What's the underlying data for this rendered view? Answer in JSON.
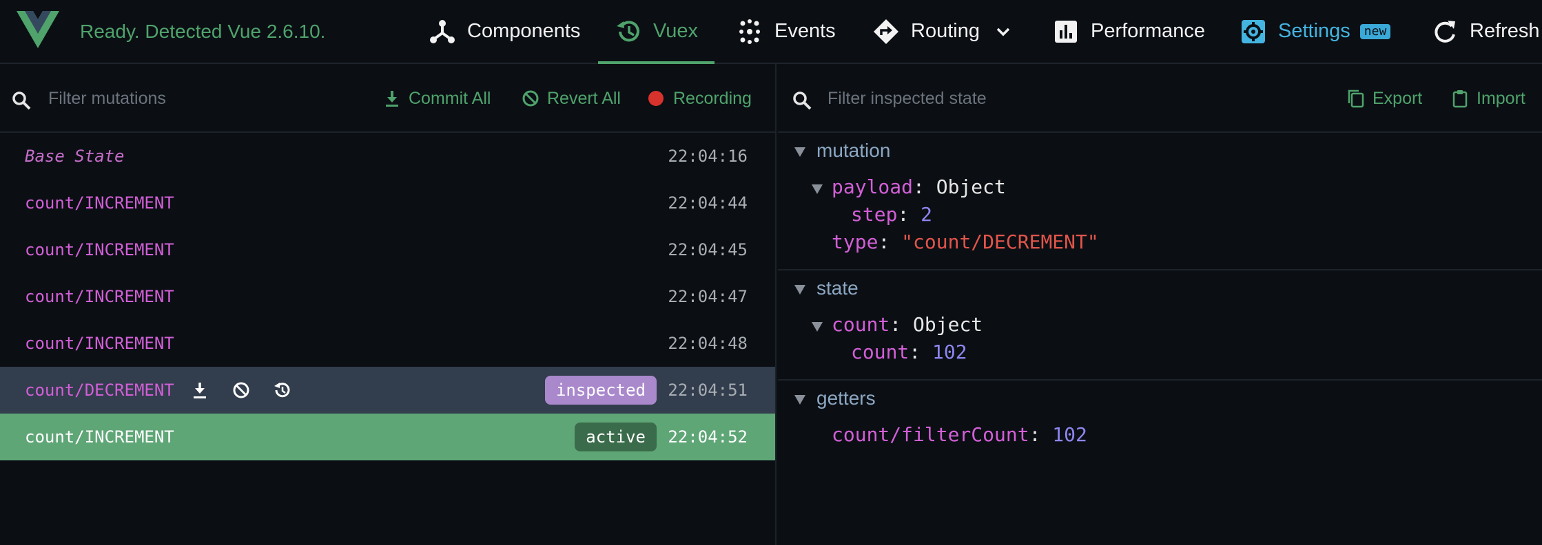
{
  "header": {
    "status": "Ready. Detected Vue 2.6.10.",
    "nav": {
      "components": "Components",
      "vuex": "Vuex",
      "events": "Events",
      "routing": "Routing",
      "performance": "Performance",
      "settings": "Settings",
      "settings_badge": "new",
      "refresh": "Refresh"
    },
    "colors": {
      "accent": "#4fa36b",
      "settings": "#44b4e0"
    }
  },
  "mutations_toolbar": {
    "filter_placeholder": "Filter mutations",
    "commit_all": "Commit All",
    "revert_all": "Revert All",
    "recording": "Recording"
  },
  "mutations": [
    {
      "name": "Base State",
      "time": "22:04:16"
    },
    {
      "name": "count/INCREMENT",
      "time": "22:04:44"
    },
    {
      "name": "count/INCREMENT",
      "time": "22:04:45"
    },
    {
      "name": "count/INCREMENT",
      "time": "22:04:47"
    },
    {
      "name": "count/INCREMENT",
      "time": "22:04:48"
    },
    {
      "name": "count/DECREMENT",
      "time": "22:04:51",
      "badge": "inspected"
    },
    {
      "name": "count/INCREMENT",
      "time": "22:04:52",
      "badge": "active"
    }
  ],
  "inspector_toolbar": {
    "filter_placeholder": "Filter inspected state",
    "export": "Export",
    "import": "Import"
  },
  "inspector": {
    "mutation": {
      "title": "mutation",
      "payload_key": "payload",
      "payload_type": "Object",
      "step_key": "step",
      "step_value": "2",
      "type_key": "type",
      "type_value": "\"count/DECREMENT\""
    },
    "state": {
      "title": "state",
      "count_key": "count",
      "count_type": "Object",
      "inner_key": "count",
      "inner_value": "102"
    },
    "getters": {
      "title": "getters",
      "key": "count/filterCount",
      "value": "102"
    }
  }
}
